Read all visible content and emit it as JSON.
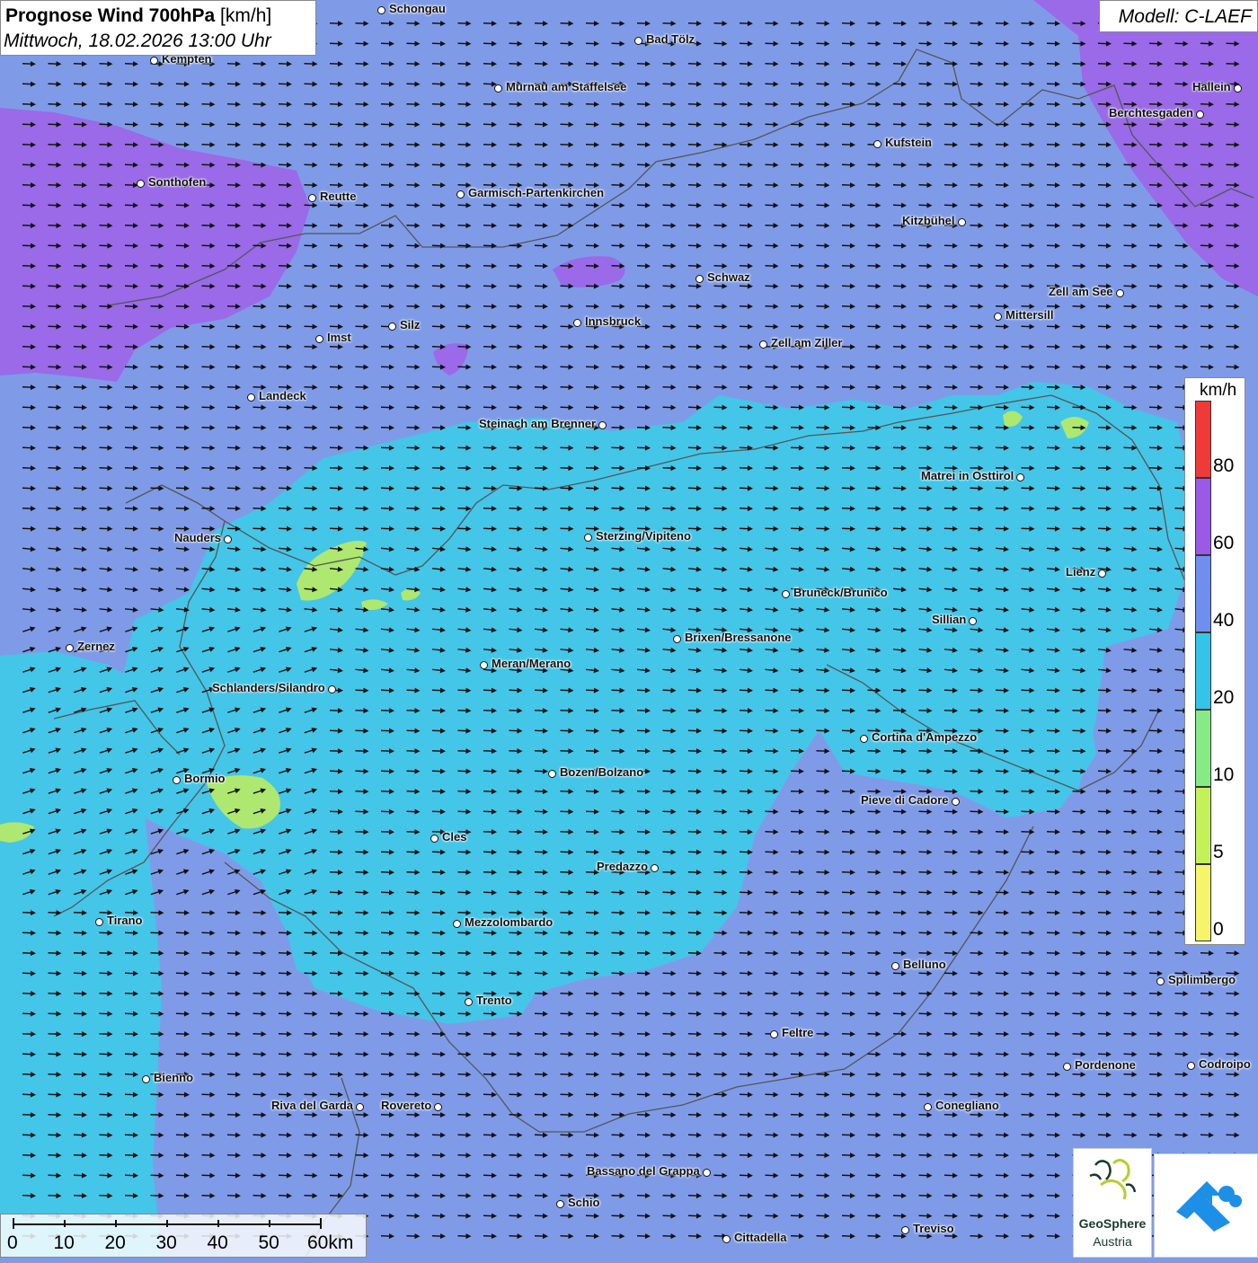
{
  "title": {
    "line1_bold": "Prognose Wind 700hPa",
    "line1_unit": "[km/h]",
    "line2": "Mittwoch, 18.02.2026 13:00 Uhr"
  },
  "model_label": "Modell: C-LAEF",
  "legend": {
    "unit": "km/h",
    "labels": [
      "80",
      "60",
      "40",
      "20",
      "10",
      "5",
      "0"
    ],
    "colors": [
      "#f03a3a",
      "#9a5ae6",
      "#6e8ef0",
      "#34c4ea",
      "#86ea86",
      "#c4f05a",
      "#f6f46a"
    ]
  },
  "colors": {
    "base": "#7f9be8",
    "zone_violet": "#9a6ae8",
    "zone_cyan": "#44c6e8",
    "zone_green": "#aee870",
    "arrow": "#111111",
    "border": "#555555"
  },
  "scalebar": {
    "labels": [
      "0",
      "10",
      "20",
      "30",
      "40",
      "50",
      "60km"
    ]
  },
  "logos": {
    "geosphere_line1": "GeoSphere",
    "geosphere_line2": "Austria"
  },
  "cities": [
    {
      "name": "Schongau"
    },
    {
      "name": "Bad Tölz"
    },
    {
      "name": "Kempten"
    },
    {
      "name": "Murnau am Staffelsee"
    },
    {
      "name": "Hallein"
    },
    {
      "name": "Berchtesgaden"
    },
    {
      "name": "Kufstein"
    },
    {
      "name": "Sonthofen"
    },
    {
      "name": "Reutte"
    },
    {
      "name": "Garmisch-Partenkirchen"
    },
    {
      "name": "Kitzbühel"
    },
    {
      "name": "Schwaz"
    },
    {
      "name": "Zell am See"
    },
    {
      "name": "Mittersill"
    },
    {
      "name": "Innsbruck"
    },
    {
      "name": "Silz"
    },
    {
      "name": "Imst"
    },
    {
      "name": "Zell am Ziller"
    },
    {
      "name": "Landeck"
    },
    {
      "name": "Steinach am Brenner"
    },
    {
      "name": "Matrei in Osttirol"
    },
    {
      "name": "Nauders"
    },
    {
      "name": "Sterzing/Vipiteno"
    },
    {
      "name": "Lienz"
    },
    {
      "name": "Bruneck/Brunico"
    },
    {
      "name": "Sillian"
    },
    {
      "name": "Brixen/Bressanone"
    },
    {
      "name": "Zernez"
    },
    {
      "name": "Meran/Merano"
    },
    {
      "name": "Schlanders/Silandro"
    },
    {
      "name": "Cortina d'Ampezzo"
    },
    {
      "name": "Bozen/Bolzano"
    },
    {
      "name": "Bormio"
    },
    {
      "name": "Pieve di Cadore"
    },
    {
      "name": "Cles"
    },
    {
      "name": "Predazzo"
    },
    {
      "name": "Tirano"
    },
    {
      "name": "Mezzolombardo"
    },
    {
      "name": "Belluno"
    },
    {
      "name": "Spilimbergo"
    },
    {
      "name": "Trento"
    },
    {
      "name": "Feltre"
    },
    {
      "name": "Bienno"
    },
    {
      "name": "Pordenone"
    },
    {
      "name": "Codroipo"
    },
    {
      "name": "Riva del Garda"
    },
    {
      "name": "Rovereto"
    },
    {
      "name": "Conegliano"
    },
    {
      "name": "Bassano del Grappa"
    },
    {
      "name": "Schio"
    },
    {
      "name": "Treviso"
    },
    {
      "name": "Cittadella"
    }
  ]
}
